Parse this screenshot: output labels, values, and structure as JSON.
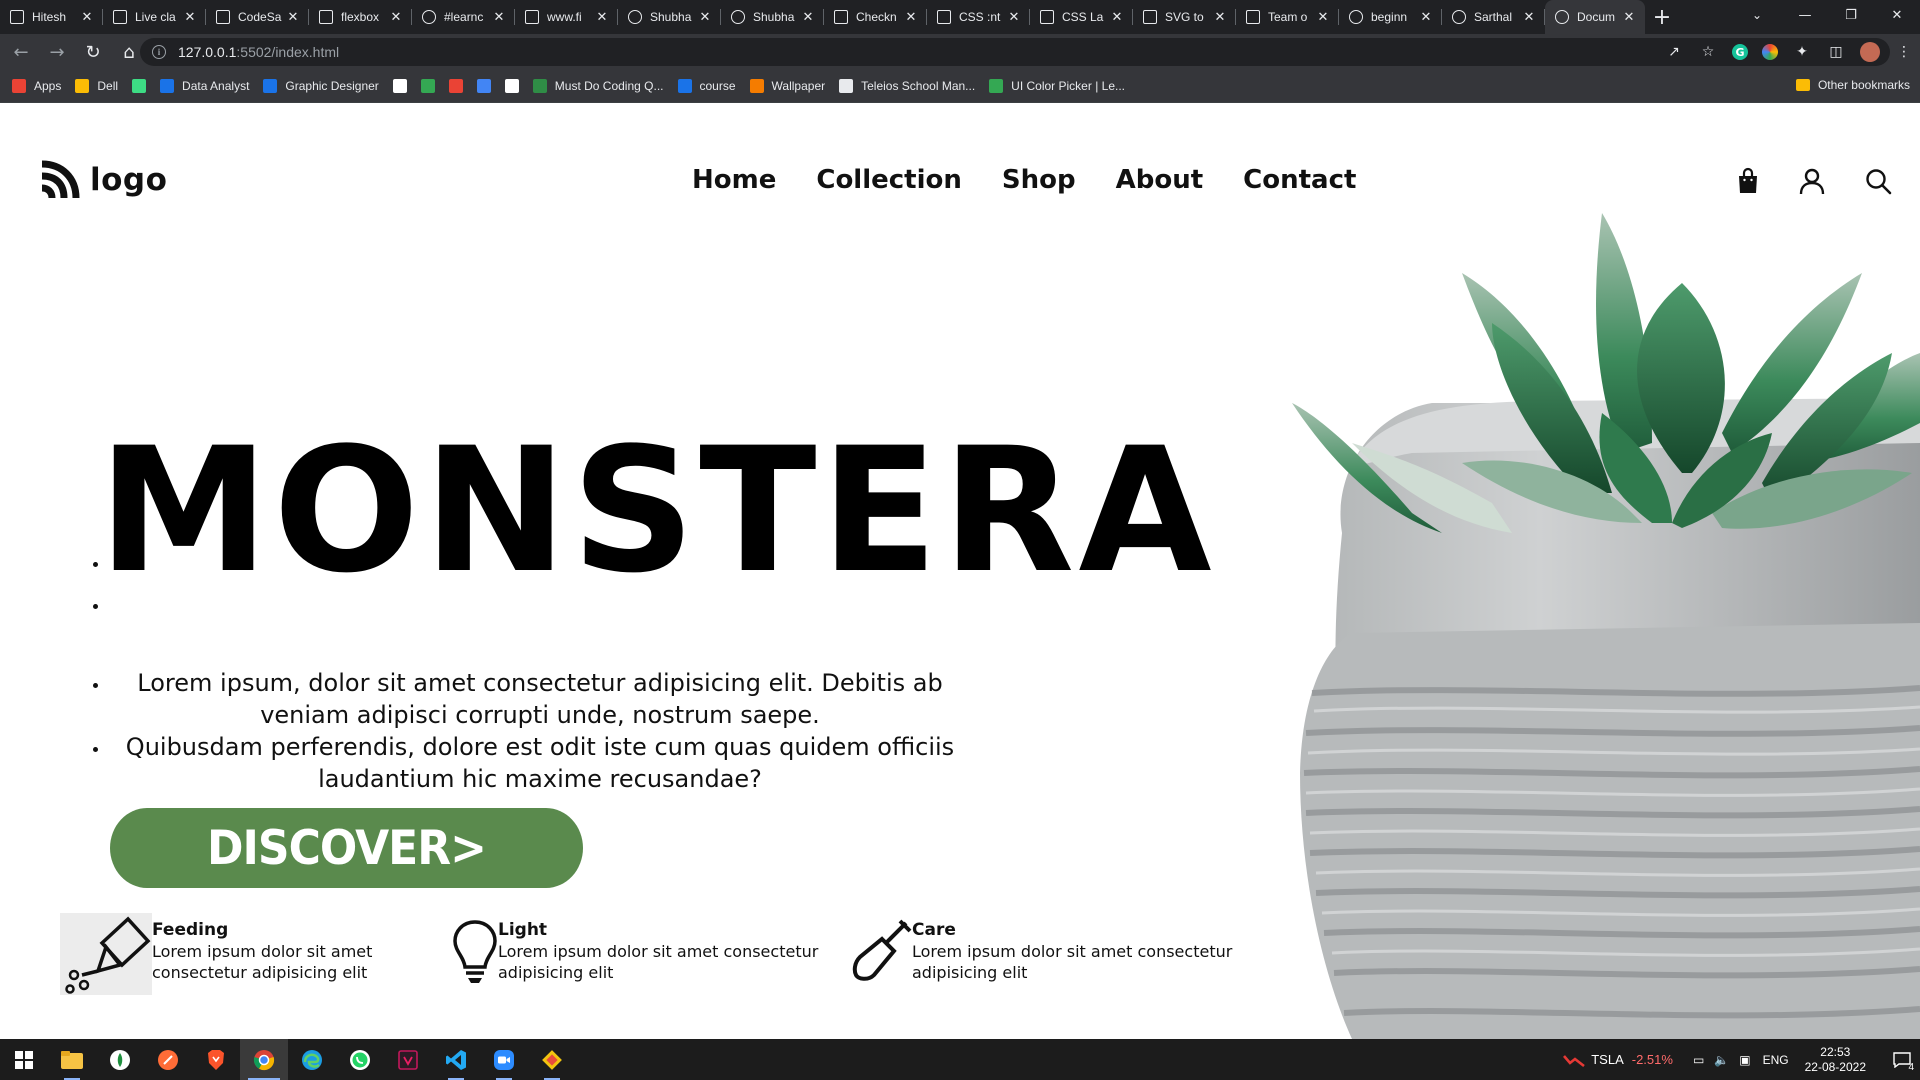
{
  "browser": {
    "tabs": [
      {
        "title": "Hitesh",
        "icon": "square-page-icon"
      },
      {
        "title": "Live cla",
        "icon": "square-page-icon"
      },
      {
        "title": "CodeSa",
        "icon": "square-page-icon"
      },
      {
        "title": "flexbox",
        "icon": "cloud-icon"
      },
      {
        "title": "#learnc",
        "icon": "hashnode-icon"
      },
      {
        "title": "www.fi",
        "icon": "code-brackets-icon"
      },
      {
        "title": "Shubha",
        "icon": "globe-icon"
      },
      {
        "title": "Shubha",
        "icon": "github-icon"
      },
      {
        "title": "Checkn",
        "icon": "codepen-icon"
      },
      {
        "title": "CSS :nt",
        "icon": "w3schools-icon"
      },
      {
        "title": "CSS La",
        "icon": "w3schools-icon"
      },
      {
        "title": "SVG to",
        "icon": "svg-png-icon"
      },
      {
        "title": "Team o",
        "icon": "diamond-icon"
      },
      {
        "title": "beginn",
        "icon": "google-icon"
      },
      {
        "title": "Sarthal",
        "icon": "github-icon"
      },
      {
        "title": "Docum",
        "icon": "globe-icon",
        "active": true
      }
    ],
    "new_tab": "+",
    "url_host": "127.0.0.1",
    "url_rest": ":5502/index.html",
    "bookmarks": [
      {
        "label": "Apps",
        "icon": "apps-grid-icon",
        "color": "#ea4335"
      },
      {
        "label": "Dell",
        "icon": "folder-icon",
        "color": "#fbbc05"
      },
      {
        "label": "",
        "icon": "android-icon",
        "color": "#3ddc84"
      },
      {
        "label": "Data Analyst",
        "icon": "flag-icon",
        "color": "#1a73e8"
      },
      {
        "label": "Graphic Designer",
        "icon": "flag-icon",
        "color": "#1a73e8"
      },
      {
        "label": "",
        "icon": "globe-icon",
        "color": "#ffffff"
      },
      {
        "label": "",
        "icon": "mountain-icon",
        "color": "#34a853"
      },
      {
        "label": "",
        "icon": "v-icon",
        "color": "#ea4335"
      },
      {
        "label": "",
        "icon": "link-icon",
        "color": "#4285f4"
      },
      {
        "label": "",
        "icon": "qr-icon",
        "color": "#ffffff"
      },
      {
        "label": "Must Do Coding Q...",
        "icon": "gfg-icon",
        "color": "#2f8d46"
      },
      {
        "label": "course",
        "icon": "c-icon",
        "color": "#1a73e8"
      },
      {
        "label": "Wallpaper",
        "icon": "fire-icon",
        "color": "#f57c00"
      },
      {
        "label": "Teleios School Man...",
        "icon": "doc-icon",
        "color": "#e8eaed"
      },
      {
        "label": "UI Color Picker | Le...",
        "icon": "play-icon",
        "color": "#34a853"
      }
    ],
    "other_bookmarks": "Other bookmarks"
  },
  "page": {
    "logo_text": "logo",
    "nav": [
      "Home",
      "Collection",
      "Shop",
      "About",
      "Contact"
    ],
    "hero_title": "MONSTERA",
    "hero_paragraphs": [
      "Lorem ipsum, dolor sit amet consectetur adipisicing elit. Debitis ab veniam adipisci corrupti unde, nostrum saepe.",
      "Quibusdam perferendis, dolore est odit iste cum quas quidem officiis laudantium hic maxime recusandae?"
    ],
    "cta_label": "DISCOVER>",
    "features": [
      {
        "title": "Feeding",
        "text": "Lorem ipsum dolor sit amet consectetur adipisicing elit",
        "icon": "watering-can-icon"
      },
      {
        "title": "Light",
        "text": "Lorem ipsum dolor sit amet consectetur adipisicing elit",
        "icon": "light-bulb-icon"
      },
      {
        "title": "Care",
        "text": "Lorem ipsum dolor sit amet consectetur adipisicing elit",
        "icon": "shovel-icon"
      }
    ],
    "accent_color": "#5a8a4d"
  },
  "taskbar": {
    "apps": [
      "windows-start-icon",
      "file-explorer-icon",
      "app-green-icon",
      "postman-icon",
      "brave-icon",
      "chrome-icon",
      "edge-icon",
      "whatsapp-icon",
      "vectr-icon",
      "vscode-icon",
      "zoom-icon",
      "git-icon"
    ],
    "stock_symbol": "TSLA",
    "stock_change": "-2.51%",
    "language": "ENG",
    "time": "22:53",
    "date": "22-08-2022",
    "notifications": "4"
  }
}
